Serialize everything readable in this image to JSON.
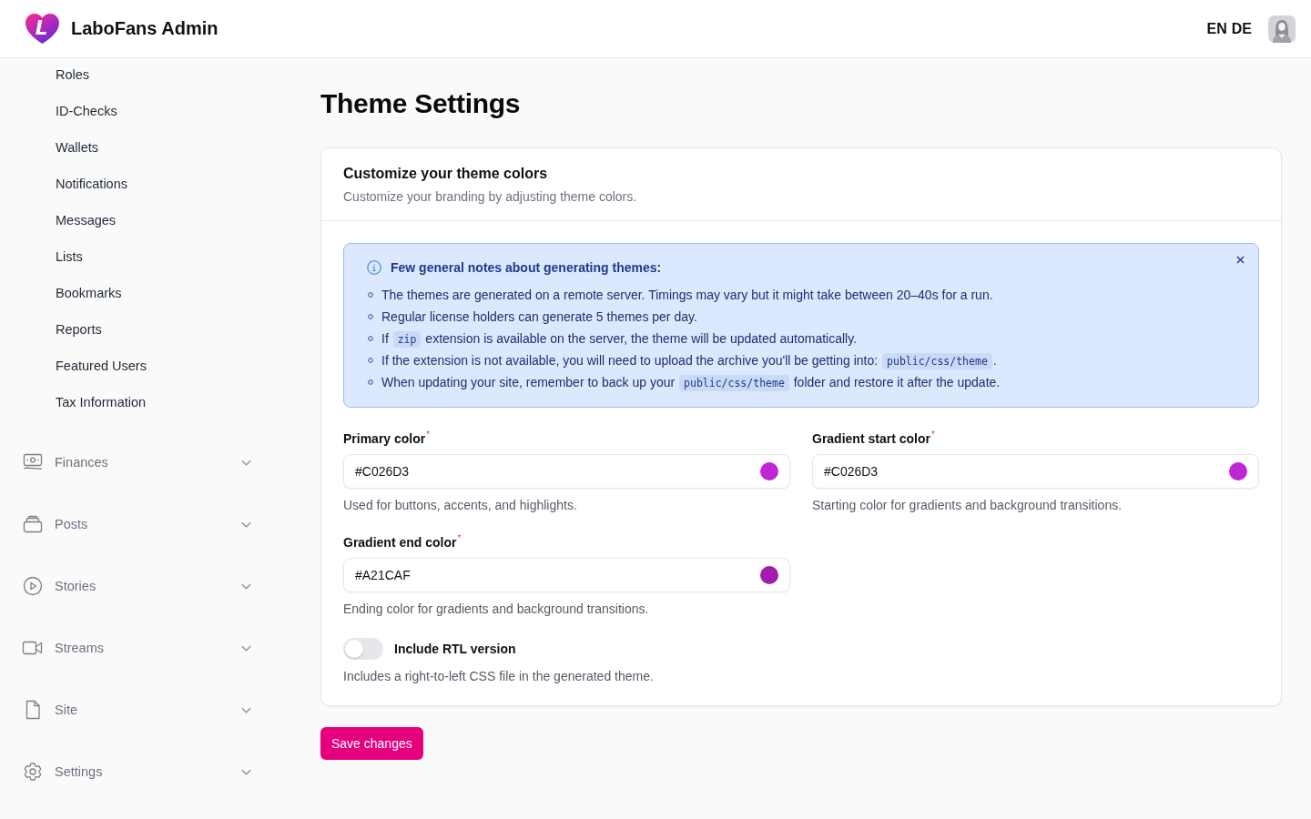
{
  "header": {
    "logo_mark": "L",
    "app_name": "LaboFans Admin",
    "languages": [
      "EN",
      "DE"
    ]
  },
  "sidebar": {
    "sub_items": [
      {
        "label": "Roles",
        "selected": false
      },
      {
        "label": "ID-Checks",
        "selected": false
      },
      {
        "label": "Wallets",
        "selected": false
      },
      {
        "label": "Notifications",
        "selected": false
      },
      {
        "label": "Messages",
        "selected": false
      },
      {
        "label": "Lists",
        "selected": false
      },
      {
        "label": "Bookmarks",
        "selected": false
      },
      {
        "label": "Reports",
        "selected": false
      },
      {
        "label": "Featured Users",
        "selected": false
      },
      {
        "label": "Tax Information",
        "selected": false
      }
    ],
    "groups": [
      {
        "label": "Finances",
        "expanded": false
      },
      {
        "label": "Posts",
        "expanded": false
      },
      {
        "label": "Stories",
        "expanded": false
      },
      {
        "label": "Streams",
        "expanded": false
      },
      {
        "label": "Site",
        "expanded": false
      },
      {
        "label": "Settings",
        "expanded": false
      }
    ]
  },
  "page": {
    "title": "Theme Settings"
  },
  "card": {
    "title": "Customize your theme colors",
    "subtitle": "Customize your branding by adjusting theme colors.",
    "alert": {
      "title": "Few general notes about generating themes:",
      "items": [
        {
          "segments": [
            {
              "kind": "text",
              "text": "The themes are generated on a remote server. Timings may vary but it might take between 20–40s for a run."
            }
          ]
        },
        {
          "segments": [
            {
              "kind": "text",
              "text": "Regular license holders can generate 5 themes per day."
            }
          ]
        },
        {
          "segments": [
            {
              "kind": "text",
              "text": "If "
            },
            {
              "kind": "code",
              "text": "zip"
            },
            {
              "kind": "text",
              "text": " extension is available on the server, the theme will be updated automatically."
            }
          ]
        },
        {
          "segments": [
            {
              "kind": "text",
              "text": "If the extension is not available, you will need to upload the archive you'll be getting into: "
            },
            {
              "kind": "code",
              "text": "public/css/theme"
            },
            {
              "kind": "text",
              "text": "."
            }
          ]
        },
        {
          "segments": [
            {
              "kind": "text",
              "text": "When updating your site, remember to back up your "
            },
            {
              "kind": "code",
              "text": "public/css/theme"
            },
            {
              "kind": "text",
              "text": " folder and restore it after the update."
            }
          ]
        }
      ]
    },
    "fields": [
      {
        "label": "Primary color",
        "required_mark": "*",
        "value": "#C026D3",
        "color": "#c026d3",
        "help": "Used for buttons, accents, and highlights."
      },
      {
        "label": "Gradient start color",
        "required_mark": "*",
        "value": "#C026D3",
        "color": "#c026d3",
        "help": "Starting color for gradients and background transitions."
      },
      {
        "label": "Gradient end color",
        "required_mark": "*",
        "value": "#A21CAF",
        "color": "#a21caf",
        "help": "Ending color for gradients and background transitions."
      }
    ],
    "toggle": {
      "label": "Include RTL version",
      "on": false,
      "help": "Includes a right-to-left CSS file in the generated theme."
    }
  },
  "save_button": "Save changes"
}
